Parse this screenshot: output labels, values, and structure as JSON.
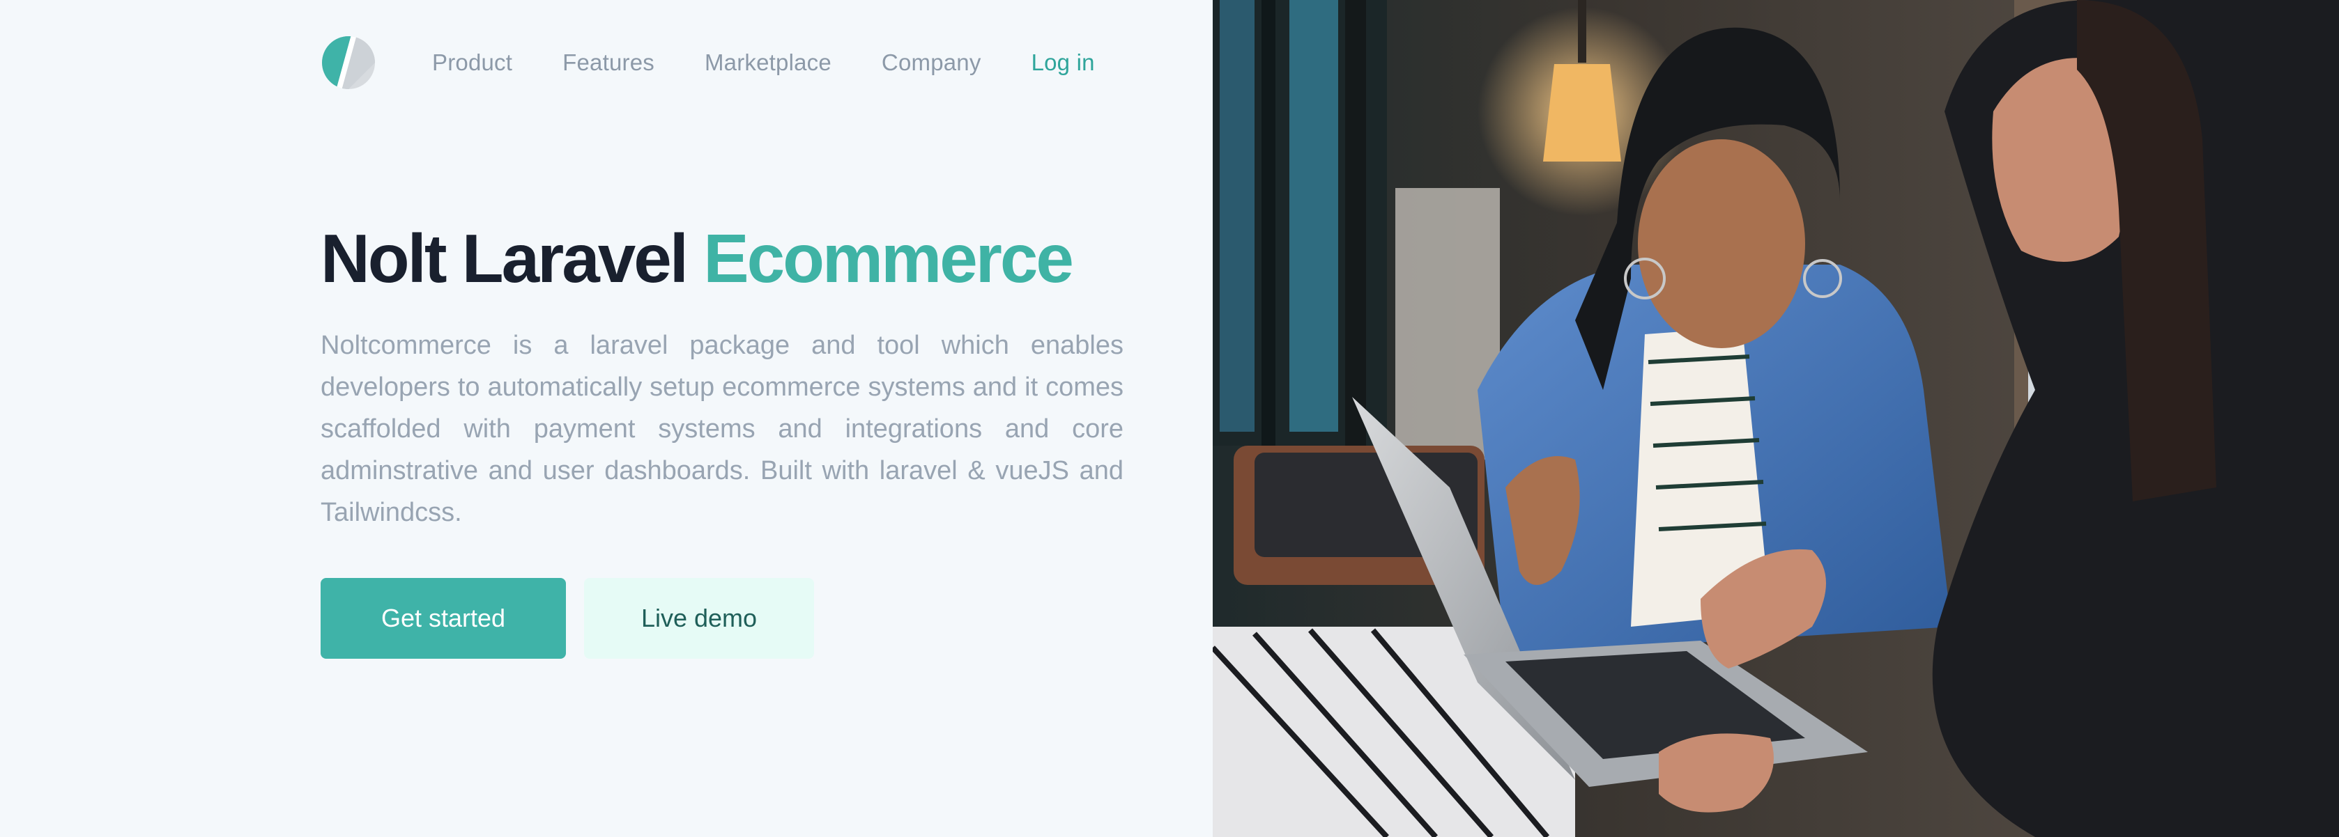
{
  "nav": {
    "logo_icon": "nolt-logo-icon",
    "links": [
      {
        "label": "Product"
      },
      {
        "label": "Features"
      },
      {
        "label": "Marketplace"
      },
      {
        "label": "Company"
      }
    ],
    "login_label": "Log in"
  },
  "hero": {
    "title_main": "Nolt Laravel ",
    "title_accent": "Ecommerce",
    "description": "Noltcommerce is a laravel package and tool which enables developers to automatically setup ecommerce systems and it comes scaffolded with payment systems and integrations and core adminstrative and user dashboards. Built with laravel & vueJS and Tailwindcss.",
    "primary_cta": "Get started",
    "secondary_cta": "Live demo"
  },
  "colors": {
    "accent": "#3fb3a8",
    "heading": "#19202e",
    "muted_text": "#98a4b2",
    "secondary_button_bg": "#e6fbf6"
  },
  "hero_image": {
    "subject": "two women looking at a laptop in a cafe"
  }
}
